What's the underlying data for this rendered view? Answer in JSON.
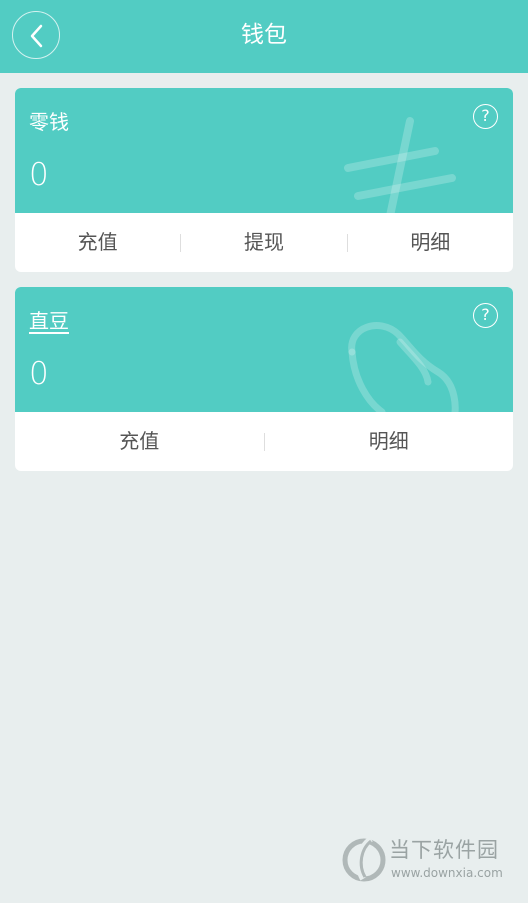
{
  "header": {
    "title": "钱包"
  },
  "cards": [
    {
      "label": "零钱",
      "value": "0",
      "help": "?",
      "actions": [
        "充值",
        "提现",
        "明细"
      ]
    },
    {
      "label": "直豆",
      "value": "0",
      "help": "?",
      "actions": [
        "充值",
        "明细"
      ]
    }
  ],
  "watermark": {
    "name": "当下软件园",
    "url": "www.downxia.com"
  },
  "colors": {
    "accent": "#52ccc3",
    "background": "#e8eeee",
    "action_text": "#555555"
  },
  "icons": {
    "back": "chevron-left-icon",
    "help": "question-circle-icon",
    "card1_deco": "yuan-sign-icon",
    "card2_deco": "bean-icon"
  }
}
